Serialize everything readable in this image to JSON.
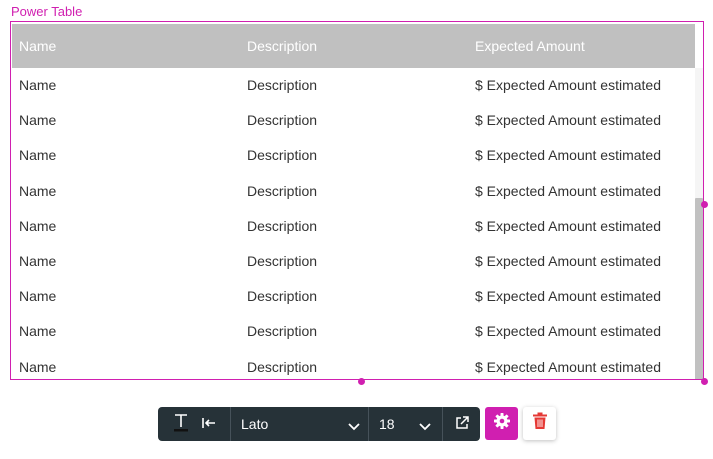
{
  "widget": {
    "label": "Power Table",
    "accent_color": "#d01fb0"
  },
  "table": {
    "columns": [
      "Name",
      "Description",
      "Expected Amount"
    ],
    "header_bg": "#c0c0c0",
    "rows": [
      [
        "Name",
        "Description",
        "$ Expected Amount estimated"
      ],
      [
        "Name",
        "Description",
        "$ Expected Amount estimated"
      ],
      [
        "Name",
        "Description",
        "$ Expected Amount estimated"
      ],
      [
        "Name",
        "Description",
        "$ Expected Amount estimated"
      ],
      [
        "Name",
        "Description",
        "$ Expected Amount estimated"
      ],
      [
        "Name",
        "Description",
        "$ Expected Amount estimated"
      ],
      [
        "Name",
        "Description",
        "$ Expected Amount estimated"
      ],
      [
        "Name",
        "Description",
        "$ Expected Amount estimated"
      ],
      [
        "Name",
        "Description",
        "$ Expected Amount estimated"
      ]
    ]
  },
  "toolbar": {
    "font_value": "Lato",
    "size_value": "18",
    "icons": [
      "text-color-icon",
      "indent-left-icon",
      "chevron-down-icon",
      "external-link-icon",
      "gear-icon",
      "trash-icon"
    ]
  }
}
